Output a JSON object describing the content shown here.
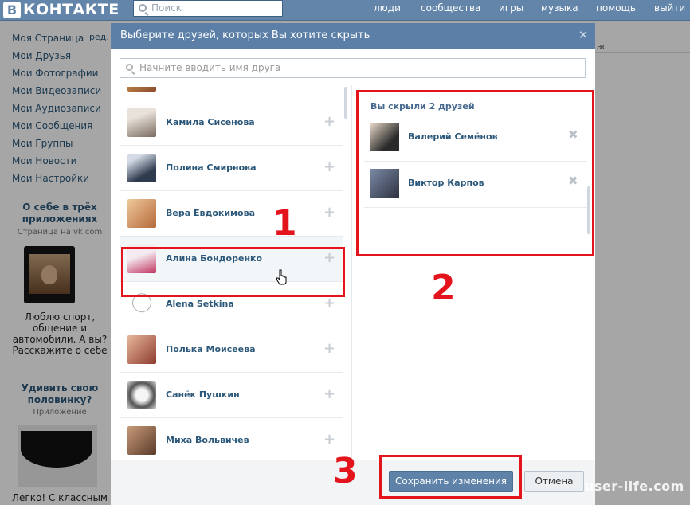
{
  "header": {
    "logo_letter": "В",
    "logo_text": "КОНТАКТЕ",
    "search_placeholder": "Поиск",
    "nav": [
      "люди",
      "сообщества",
      "игры",
      "музыка",
      "помощь",
      "выйти"
    ]
  },
  "sidebar": {
    "items": [
      "Моя Страница",
      "Мои Друзья",
      "Мои Фотографии",
      "Мои Видеозаписи",
      "Мои Аудиозаписи",
      "Мои Сообщения",
      "Мои Группы",
      "Мои Новости",
      "Мои Настройки"
    ],
    "edit": "ред.",
    "ad1": {
      "title": "О себе в трёх приложениях",
      "sub": "Страница на vk.com",
      "text": "Люблю спорт, общение и автомобили. А вы? Расскажите о себе"
    },
    "ad2": {
      "title": "Удивить свою половинку?",
      "sub": "Приложение",
      "text": "Легко! С классным"
    }
  },
  "background": {
    "right_fragment": "ас"
  },
  "modal": {
    "title": "Выберите друзей, которых Вы хотите скрыть",
    "filter_placeholder": "Начните вводить имя друга",
    "friends": [
      "Камила Сисенова",
      "Полина Смирнова",
      "Вера Евдокимова",
      "Алина Бондоренко",
      "Alena Setkina",
      "Полька Моисеева",
      "Санёк Пушкин",
      "Миха Вольвичев"
    ],
    "hidden_title": "Вы скрыли 2 друзей",
    "hidden_friends": [
      "Валерий Семёнов",
      "Виктор Карпов"
    ],
    "save_label": "Сохранить изменения",
    "cancel_label": "Отмена"
  },
  "annotations": {
    "n1": "1",
    "n2": "2",
    "n3": "3"
  },
  "watermark": "user-life.com",
  "colors": {
    "header_blue": "#6285a9",
    "modal_header": "#5b7fa6",
    "link": "#2b587a",
    "annotation_red": "#e3141c"
  }
}
